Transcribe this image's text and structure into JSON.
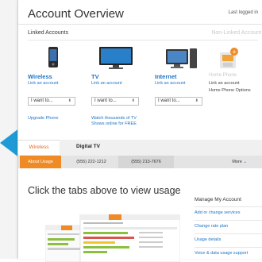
{
  "header": {
    "title": "Account Overview",
    "last_logged": "Last logged in"
  },
  "sections": {
    "linked": "Linked Accounts",
    "non_linked": "Non-Linked Account"
  },
  "columns": [
    {
      "name": "Wireless",
      "link": "Link an account",
      "select": "I want to...",
      "extra": "Upgrade Phone",
      "icon": "mobile-phone-icon"
    },
    {
      "name": "TV",
      "link": "Link an account",
      "select": "I want to...",
      "extra": "Watch thousands of TV Shows online for FREE",
      "icon": "tv-icon"
    },
    {
      "name": "Internet",
      "link": "Link an account",
      "select": "I want to...",
      "extra": "",
      "icon": "computer-icon"
    },
    {
      "name": "Home Phone",
      "link": "Link an account",
      "link2": "Home Phone Options",
      "icon": "home-phone-icon"
    }
  ],
  "tabs": {
    "wireless": "Wireless",
    "digital_tv": "Digital TV"
  },
  "subtabs": {
    "about": "About Usage",
    "line1": "(555) 222-1212",
    "line2": "(555) 213-7676",
    "more": "More"
  },
  "main": {
    "headline": "Click the tabs above to view usage"
  },
  "manage": {
    "title": "Manage My Account",
    "items": [
      "Add or change services",
      "Change rate plan",
      "Usage details",
      "Voice & data usage support"
    ]
  },
  "colors": {
    "accent_blue": "#1e9bd7",
    "link_blue": "#1e73c8",
    "orange": "#f08a24"
  }
}
